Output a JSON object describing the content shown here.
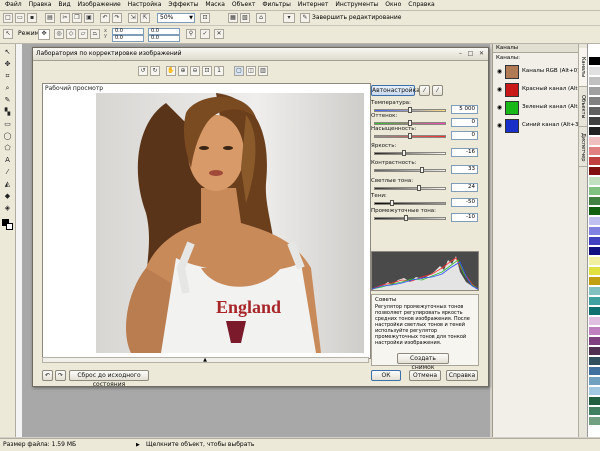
{
  "menu": [
    "Файл",
    "Правка",
    "Вид",
    "Изображение",
    "Настройка",
    "Эффекты",
    "Маска",
    "Объект",
    "Фильтры",
    "Интернет",
    "Инструменты",
    "Окно",
    "Справка"
  ],
  "toolbar": {
    "zoom_value": "50%",
    "finish_editing_label": "Завершить редактирование",
    "mode_label": "Режим"
  },
  "property_bar": {
    "x": "0.0",
    "y": "0.0"
  },
  "dialog": {
    "title": "Лаборатория по корректировке изображений",
    "preview_label": "Рабочий просмотр",
    "auto_adjust_label": "Автонастройка",
    "controls": [
      {
        "label": "Температура:",
        "value": "5 000",
        "level": 0.5
      },
      {
        "label": "Оттенок:",
        "value": "0",
        "level": 0.5
      },
      {
        "label": "Насыщенность:",
        "value": "0",
        "level": 0.5
      },
      {
        "label": "Яркость:",
        "value": "-16",
        "level": 0.42
      },
      {
        "label": "Контрастность:",
        "value": "33",
        "level": 0.66
      },
      {
        "label": "Светлые тона:",
        "value": "24",
        "level": 0.62
      },
      {
        "label": "Тени:",
        "value": "-50",
        "level": 0.25
      },
      {
        "label": "Промежуточные тона:",
        "value": "-10",
        "level": 0.45
      }
    ],
    "tips_title": "Советы",
    "tips_text": "Регулятор промежуточных тонов позволяет регулировать яркость средних тонов изображения. После настройки светлых тонов и теней используйте регулятор промежуточных тонов для тонкой настройки изображения.",
    "snapshot_label": "Создать снимок",
    "reset_label": "Сброс до исходного состояния",
    "ok_label": "ОК",
    "cancel_label": "Отмена",
    "help_label": "Справка",
    "photo_shirt_text": "England"
  },
  "docker": {
    "title": "Каналы",
    "section_label": "Каналы:",
    "channels": [
      {
        "name": "Каналы RGB (Alt+0)",
        "color": "#b07a55"
      },
      {
        "name": "Красный канал (Alt+1)",
        "color": "#c81818"
      },
      {
        "name": "Зеленый канал (Alt+2)",
        "color": "#18b818"
      },
      {
        "name": "Синий канал (Alt+3)",
        "color": "#1830c8"
      }
    ]
  },
  "vertical_tabs": [
    "Каналы",
    "Объекты",
    "Диспетчер"
  ],
  "status": {
    "file_size": "Размер файла: 1.59 МБ",
    "hint": "Щелкните объект, чтобы выбрать"
  },
  "colors": {
    "palette": [
      "#ffffff",
      "#000000",
      "#e0e0e0",
      "#c0c0c0",
      "#a0a0a0",
      "#808080",
      "#606060",
      "#404040",
      "#202020",
      "#f0c0c0",
      "#e08080",
      "#c04040",
      "#801010",
      "#c0e0c0",
      "#80c080",
      "#408040",
      "#106010",
      "#c0c0f0",
      "#8080e0",
      "#4040c0",
      "#101080",
      "#f0f0a0",
      "#e0e040",
      "#c0a010",
      "#80c0c0",
      "#40a0a0",
      "#107070",
      "#e0c0e0",
      "#c080c0",
      "#804080",
      "#503050",
      "#305060",
      "#4070a0",
      "#70a0c0",
      "#a0c8e0",
      "#206040",
      "#408060",
      "#70a080"
    ]
  }
}
